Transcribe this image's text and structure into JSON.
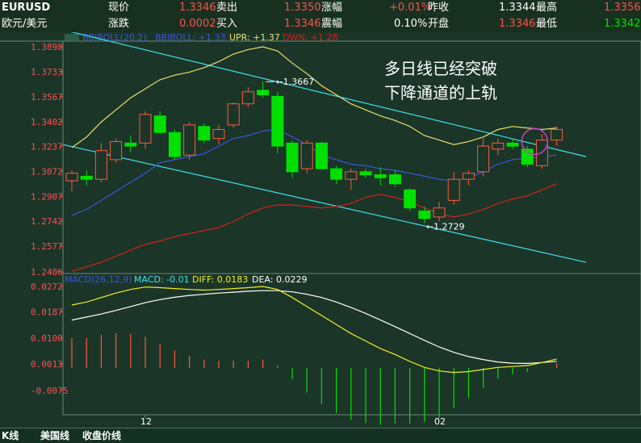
{
  "quote": {
    "symbol": "EURUSD",
    "name": "欧元/美元",
    "current_label": "现价",
    "current_value": "1.3346",
    "sell_label": "卖出",
    "sell_value": "1.3350",
    "change_pct_label": "涨幅",
    "change_pct_value": "+0.01%",
    "prev_close_label": "昨收",
    "prev_close_value": "1.3344",
    "high_label": "最高",
    "high_value": "1.3356",
    "change_label": "涨跌",
    "change_value": "0.0002",
    "buy_label": "买入",
    "buy_value": "1.3346",
    "amplitude_label": "震幅",
    "amplitude_value": "0.10%",
    "open_label": "开盘",
    "open_value": "1.3346",
    "low_label": "最低",
    "low_value": "1.3342"
  },
  "colors": {
    "up": "#ff5a3c",
    "down": "#00e000",
    "upper_band": "#e8e070",
    "mid_band": "#3b57d8",
    "lower_band": "#d42020",
    "channel": "#40e0f0",
    "macd": "#f0f020",
    "dea": "#ffffff",
    "marker": "#d040d0"
  },
  "chart_data": [
    {
      "type": "candlestick",
      "title": "",
      "indicator_legend": {
        "name": "BBIBOLL(20,2)",
        "mid_label": "BBIBOLL: +1.33",
        "upper_label": "UPR: +1.37",
        "lower_label": "DWN: +1.28"
      },
      "ylim": [
        1.2406,
        1.3898
      ],
      "y_ticks": [
        "1.3898",
        "1.3733",
        "1.3567",
        "1.3402",
        "1.3237",
        "1.3072",
        "1.2907",
        "1.2742",
        "1.2577",
        "1.2406"
      ],
      "x_ticks": [
        {
          "label": "12",
          "index": 5
        },
        {
          "label": "02",
          "index": 25
        }
      ],
      "candles": [
        {
          "o": 1.301,
          "h": 1.308,
          "l": 1.294,
          "c": 1.306
        },
        {
          "o": 1.304,
          "h": 1.308,
          "l": 1.298,
          "c": 1.302
        },
        {
          "o": 1.302,
          "h": 1.326,
          "l": 1.3,
          "c": 1.321
        },
        {
          "o": 1.315,
          "h": 1.329,
          "l": 1.313,
          "c": 1.327
        },
        {
          "o": 1.326,
          "h": 1.331,
          "l": 1.32,
          "c": 1.324
        },
        {
          "o": 1.326,
          "h": 1.347,
          "l": 1.322,
          "c": 1.345
        },
        {
          "o": 1.344,
          "h": 1.347,
          "l": 1.332,
          "c": 1.333
        },
        {
          "o": 1.333,
          "h": 1.335,
          "l": 1.315,
          "c": 1.317
        },
        {
          "o": 1.318,
          "h": 1.34,
          "l": 1.315,
          "c": 1.338
        },
        {
          "o": 1.337,
          "h": 1.339,
          "l": 1.326,
          "c": 1.328
        },
        {
          "o": 1.329,
          "h": 1.338,
          "l": 1.325,
          "c": 1.335
        },
        {
          "o": 1.338,
          "h": 1.353,
          "l": 1.336,
          "c": 1.352
        },
        {
          "o": 1.352,
          "h": 1.363,
          "l": 1.35,
          "c": 1.36
        },
        {
          "o": 1.361,
          "h": 1.3667,
          "l": 1.356,
          "c": 1.358
        },
        {
          "o": 1.357,
          "h": 1.36,
          "l": 1.319,
          "c": 1.324
        },
        {
          "o": 1.326,
          "h": 1.328,
          "l": 1.303,
          "c": 1.307
        },
        {
          "o": 1.309,
          "h": 1.328,
          "l": 1.306,
          "c": 1.326
        },
        {
          "o": 1.326,
          "h": 1.327,
          "l": 1.308,
          "c": 1.309
        },
        {
          "o": 1.309,
          "h": 1.311,
          "l": 1.299,
          "c": 1.302
        },
        {
          "o": 1.302,
          "h": 1.309,
          "l": 1.295,
          "c": 1.307
        },
        {
          "o": 1.307,
          "h": 1.309,
          "l": 1.303,
          "c": 1.305
        },
        {
          "o": 1.305,
          "h": 1.31,
          "l": 1.298,
          "c": 1.303
        },
        {
          "o": 1.305,
          "h": 1.308,
          "l": 1.297,
          "c": 1.299
        },
        {
          "o": 1.295,
          "h": 1.296,
          "l": 1.281,
          "c": 1.283
        },
        {
          "o": 1.281,
          "h": 1.284,
          "l": 1.2729,
          "c": 1.276
        },
        {
          "o": 1.277,
          "h": 1.287,
          "l": 1.274,
          "c": 1.283
        },
        {
          "o": 1.288,
          "h": 1.307,
          "l": 1.285,
          "c": 1.302
        },
        {
          "o": 1.302,
          "h": 1.308,
          "l": 1.298,
          "c": 1.306
        },
        {
          "o": 1.307,
          "h": 1.329,
          "l": 1.304,
          "c": 1.324
        },
        {
          "o": 1.322,
          "h": 1.329,
          "l": 1.318,
          "c": 1.326
        },
        {
          "o": 1.326,
          "h": 1.329,
          "l": 1.322,
          "c": 1.324
        },
        {
          "o": 1.322,
          "h": 1.324,
          "l": 1.31,
          "c": 1.312
        },
        {
          "o": 1.311,
          "h": 1.332,
          "l": 1.309,
          "c": 1.328
        },
        {
          "o": 1.328,
          "h": 1.337,
          "l": 1.324,
          "c": 1.335
        }
      ],
      "upper_band": [
        1.323,
        1.33,
        1.34,
        1.348,
        1.356,
        1.362,
        1.368,
        1.371,
        1.373,
        1.376,
        1.38,
        1.385,
        1.388,
        1.3898,
        1.387,
        1.379,
        1.372,
        1.364,
        1.358,
        1.352,
        1.348,
        1.344,
        1.341,
        1.337,
        1.331,
        1.328,
        1.325,
        1.327,
        1.33,
        1.335,
        1.337,
        1.336,
        1.335,
        1.336
      ],
      "mid_band": [
        1.278,
        1.282,
        1.288,
        1.294,
        1.3,
        1.306,
        1.313,
        1.315,
        1.317,
        1.319,
        1.324,
        1.329,
        1.331,
        1.334,
        1.335,
        1.33,
        1.325,
        1.318,
        1.315,
        1.312,
        1.311,
        1.309,
        1.308,
        1.306,
        1.304,
        1.302,
        1.301,
        1.303,
        1.307,
        1.312,
        1.315,
        1.316,
        1.317,
        1.318
      ],
      "lower_band": [
        1.241,
        1.244,
        1.247,
        1.251,
        1.255,
        1.259,
        1.261,
        1.264,
        1.266,
        1.268,
        1.27,
        1.274,
        1.279,
        1.283,
        1.285,
        1.285,
        1.284,
        1.283,
        1.284,
        1.286,
        1.29,
        1.292,
        1.29,
        1.287,
        1.283,
        1.279,
        1.277,
        1.279,
        1.282,
        1.286,
        1.289,
        1.291,
        1.295,
        1.299
      ],
      "channel_lines": [
        {
          "from": [
            0,
            1.401
          ],
          "to": [
            35,
            1.317
          ]
        },
        {
          "from": [
            0,
            1.325
          ],
          "to": [
            35,
            1.247
          ]
        }
      ],
      "annotations": [
        {
          "label": "1.3667",
          "index": 13,
          "value": 1.3667,
          "kind": "high"
        },
        {
          "label": "1.2729",
          "index": 24,
          "value": 1.2729,
          "kind": "low"
        }
      ],
      "marker_circle": {
        "index": 31.5,
        "value": 1.327
      },
      "note_lines": [
        "多日线已经突破",
        "下降通道的上轨"
      ]
    },
    {
      "type": "macd",
      "legend": {
        "name": "MACD(26,12,9)",
        "macd_label": "MACD: -0.01",
        "diff_label": "DIFF: 0.0183",
        "dea_label": "DEA: 0.0229"
      },
      "ylim": [
        -0.014,
        0.0272
      ],
      "y_ticks": [
        "0.0272",
        "0.0187",
        "0.0100",
        "0.0013",
        "-0.0075"
      ],
      "diff": [
        0.021,
        0.022,
        0.0235,
        0.025,
        0.0262,
        0.027,
        0.0268,
        0.0265,
        0.0262,
        0.026,
        0.0262,
        0.0265,
        0.0268,
        0.0272,
        0.0262,
        0.0235,
        0.0205,
        0.0175,
        0.0145,
        0.0115,
        0.009,
        0.0065,
        0.0045,
        0.0022,
        0.0002,
        -0.001,
        -0.0015,
        -0.0012,
        -0.0005,
        0.0002,
        0.0005,
        0.0008,
        0.0018,
        0.003
      ],
      "dea": [
        0.016,
        0.017,
        0.018,
        0.0192,
        0.0205,
        0.0218,
        0.0228,
        0.0236,
        0.0242,
        0.0246,
        0.025,
        0.0253,
        0.0256,
        0.0258,
        0.0258,
        0.0254,
        0.0246,
        0.0235,
        0.022,
        0.0202,
        0.0182,
        0.016,
        0.0138,
        0.0115,
        0.0092,
        0.007,
        0.0052,
        0.0038,
        0.0028,
        0.002,
        0.0016,
        0.0015,
        0.0018,
        0.0022
      ],
      "hist": [
        0.01,
        0.01,
        0.011,
        0.0116,
        0.0114,
        0.0104,
        0.008,
        0.0058,
        0.004,
        0.0028,
        0.0024,
        0.0024,
        0.0024,
        0.0028,
        0.0008,
        -0.0038,
        -0.0082,
        -0.012,
        -0.015,
        -0.0174,
        -0.0184,
        -0.019,
        -0.0186,
        -0.0186,
        -0.018,
        -0.016,
        -0.0134,
        -0.01,
        -0.0066,
        -0.0036,
        -0.0022,
        -0.0014,
        0.0,
        0.0016
      ]
    }
  ],
  "footer": {
    "tab1": "K线",
    "tab2": "美国线",
    "tab3": "收盘价线"
  }
}
